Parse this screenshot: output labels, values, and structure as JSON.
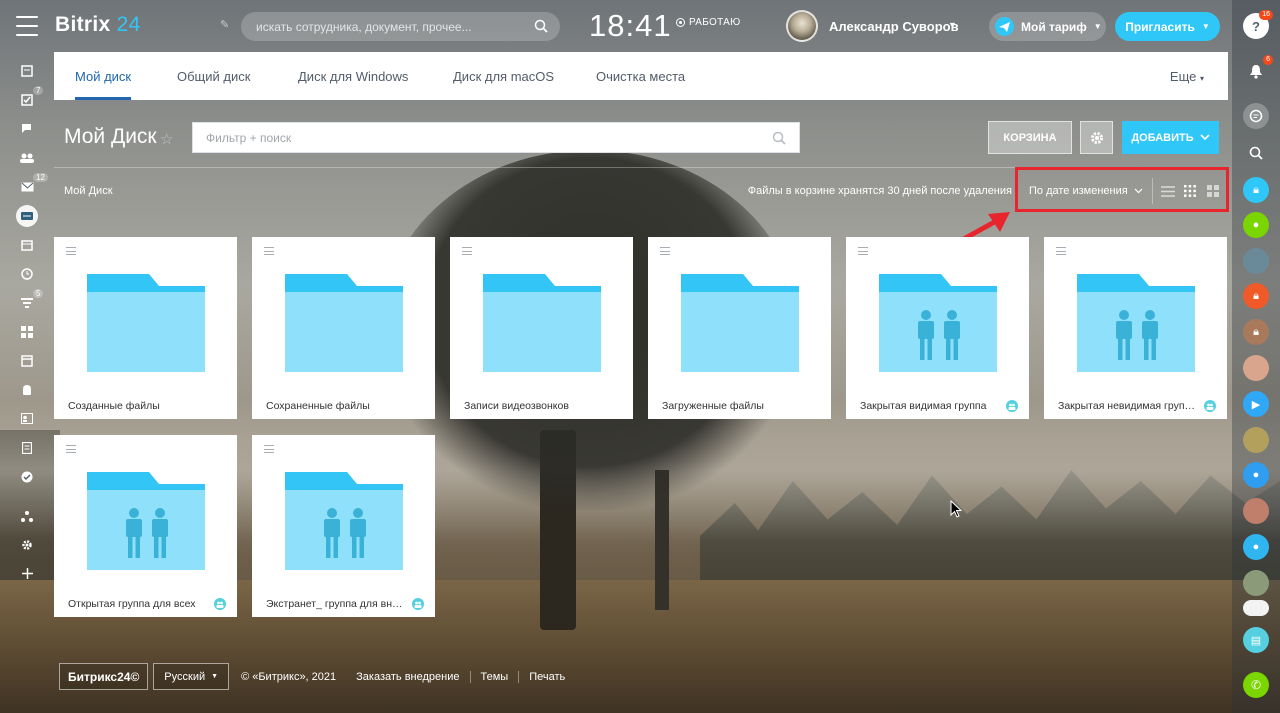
{
  "header": {
    "logo_brand": "Bitrix",
    "logo_num": "24",
    "search_placeholder": "искать сотрудника, документ, прочее...",
    "clock": "18:41",
    "work_status": "РАБОТАЮ",
    "user_name": "Александр Суворов",
    "tariff_label": "Мой тариф",
    "invite_label": "Пригласить"
  },
  "left_counters": {
    "tasks": "7",
    "mail": "12",
    "feed": "5"
  },
  "right_bar": {
    "notifications_badge": "6",
    "help_badge": "16"
  },
  "tabs": [
    {
      "label": "Мой диск",
      "active": true
    },
    {
      "label": "Общий диск"
    },
    {
      "label": "Диск для Windows"
    },
    {
      "label": "Диск для macOS"
    },
    {
      "label": "Очистка места"
    }
  ],
  "tab_more": "Еще",
  "toolbar": {
    "title": "Мой Диск",
    "filter_placeholder": "Фильтр + поиск",
    "trash_label": "КОРЗИНА",
    "add_label": "ДОБАВИТЬ"
  },
  "breadcrumb": "Мой Диск",
  "trash_note": "Файлы в корзине хранятся 30 дней после удаления",
  "sort_label": "По дате изменения",
  "folders": [
    {
      "name": "Созданные файлы",
      "group": false
    },
    {
      "name": "Сохраненные файлы",
      "group": false
    },
    {
      "name": "Записи видеозвонков",
      "group": false
    },
    {
      "name": "Загруженные файлы",
      "group": false
    },
    {
      "name": "Закрытая видимая группа",
      "group": true
    },
    {
      "name": "Закрытая невидимая группа",
      "group": true
    },
    {
      "name": "Открытая группа для всех",
      "group": true
    },
    {
      "name": "Экстранет_ группа для вне...",
      "group": true
    }
  ],
  "footer": {
    "logo": "Битрикс24©",
    "language": "Русский",
    "copyright": "© «Битрикс», 2021",
    "links": [
      "Заказать внедрение",
      "Темы",
      "Печать"
    ]
  },
  "colors": {
    "accent": "#2fc7f7",
    "active_tab": "#2067b0",
    "folder_front": "#8ee0fb",
    "folder_back": "#33c5f5",
    "highlight": "#e8242c"
  }
}
